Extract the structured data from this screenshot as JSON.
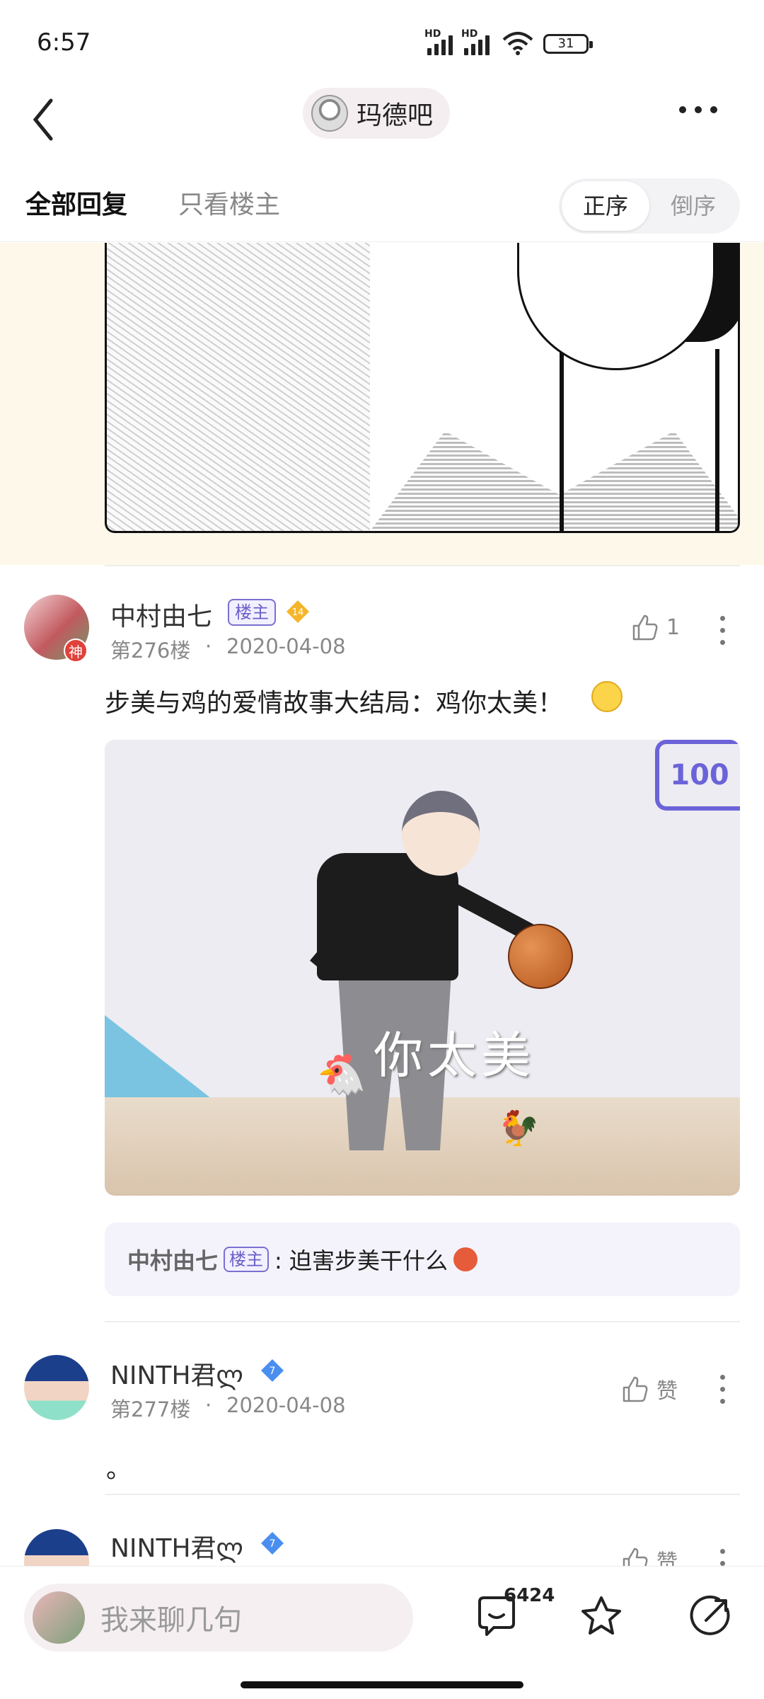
{
  "status_bar": {
    "time": "6:57",
    "sim1": "HD",
    "sim2": "HD",
    "battery": "31"
  },
  "nav": {
    "forum_name": "玛德吧"
  },
  "tabs": {
    "all_replies": "全部回复",
    "owner_only": "只看楼主",
    "order_asc": "正序",
    "order_desc": "倒序"
  },
  "posts": [
    {
      "username": "中村由七",
      "owner_tag": "楼主",
      "level": "14",
      "floor": "第276楼",
      "date": "2020-04-08",
      "likes": "1",
      "avatar_badge": "神",
      "text": "步美与鸡的爱情故事大结局：鸡你太美！",
      "image_caption": "你太美",
      "image_badge": "100",
      "reply": {
        "username": "中村由七",
        "tag": "楼主",
        "text": ": 迫害步美干什么"
      }
    },
    {
      "username": "NINTH君ლ",
      "level": "7",
      "floor": "第277楼",
      "date": "2020-04-08",
      "likes": "赞",
      "text": "。"
    },
    {
      "username": "NINTH君ლ",
      "level": "7",
      "likes": "赞"
    }
  ],
  "bottom_bar": {
    "input_placeholder": "我来聊几句",
    "comment_count": "6424"
  },
  "colors": {
    "accent": "#6b63d8",
    "tag_border": "#7a6fd0",
    "pill_bg": "#f5eff1",
    "image_bg": "#fdf8ea"
  }
}
